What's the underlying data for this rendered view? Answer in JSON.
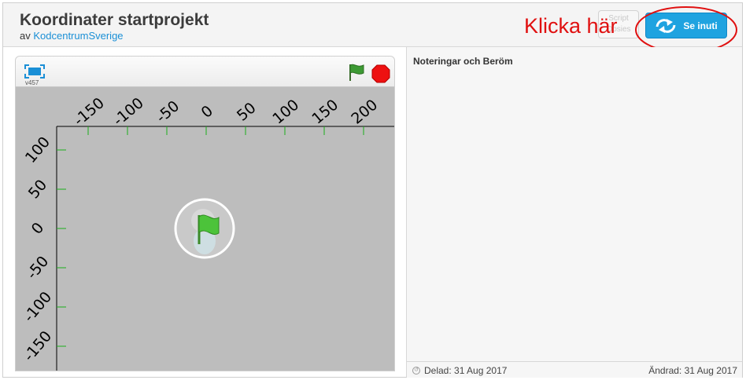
{
  "project": {
    "title": "Koordinater startprojekt",
    "by_prefix": "av",
    "author": "KodcentrumSverige"
  },
  "toolbar": {
    "remix_label": "Script\nOpsies",
    "see_inside_label": "Se inuti"
  },
  "annotation": {
    "text": "Klicka här",
    "color": "#e01010"
  },
  "player": {
    "version": "v457",
    "fullscreen_icon": "fullscreen-icon",
    "flag_icon": "green-flag-icon",
    "stop_icon": "stop-icon",
    "x_ticks": [
      "-150",
      "-100",
      "-50",
      "0",
      "50",
      "100",
      "150",
      "200"
    ],
    "y_ticks": [
      "100",
      "50",
      "0",
      "-50",
      "-100",
      "-150"
    ]
  },
  "notes": {
    "title": "Noteringar och Beröm",
    "shared": "Delad: 31 Aug 2017",
    "modified": "Ändrad: 31 Aug 2017"
  },
  "colors": {
    "accent": "#1fa3e0",
    "stage_bg": "#bdbdbd",
    "tick_green": "#1cb01c",
    "link": "#1a8fd6"
  }
}
